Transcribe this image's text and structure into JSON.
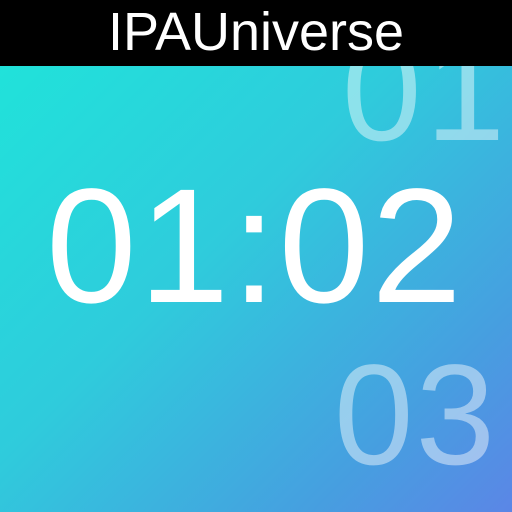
{
  "banner": {
    "title": "IPAUniverse"
  },
  "clock": {
    "previous": "01",
    "current": "01:02",
    "next": "03"
  },
  "colors": {
    "gradient_start": "#1ee6da",
    "gradient_end": "#5b86e6",
    "banner_bg": "#000000",
    "text": "#ffffff"
  }
}
